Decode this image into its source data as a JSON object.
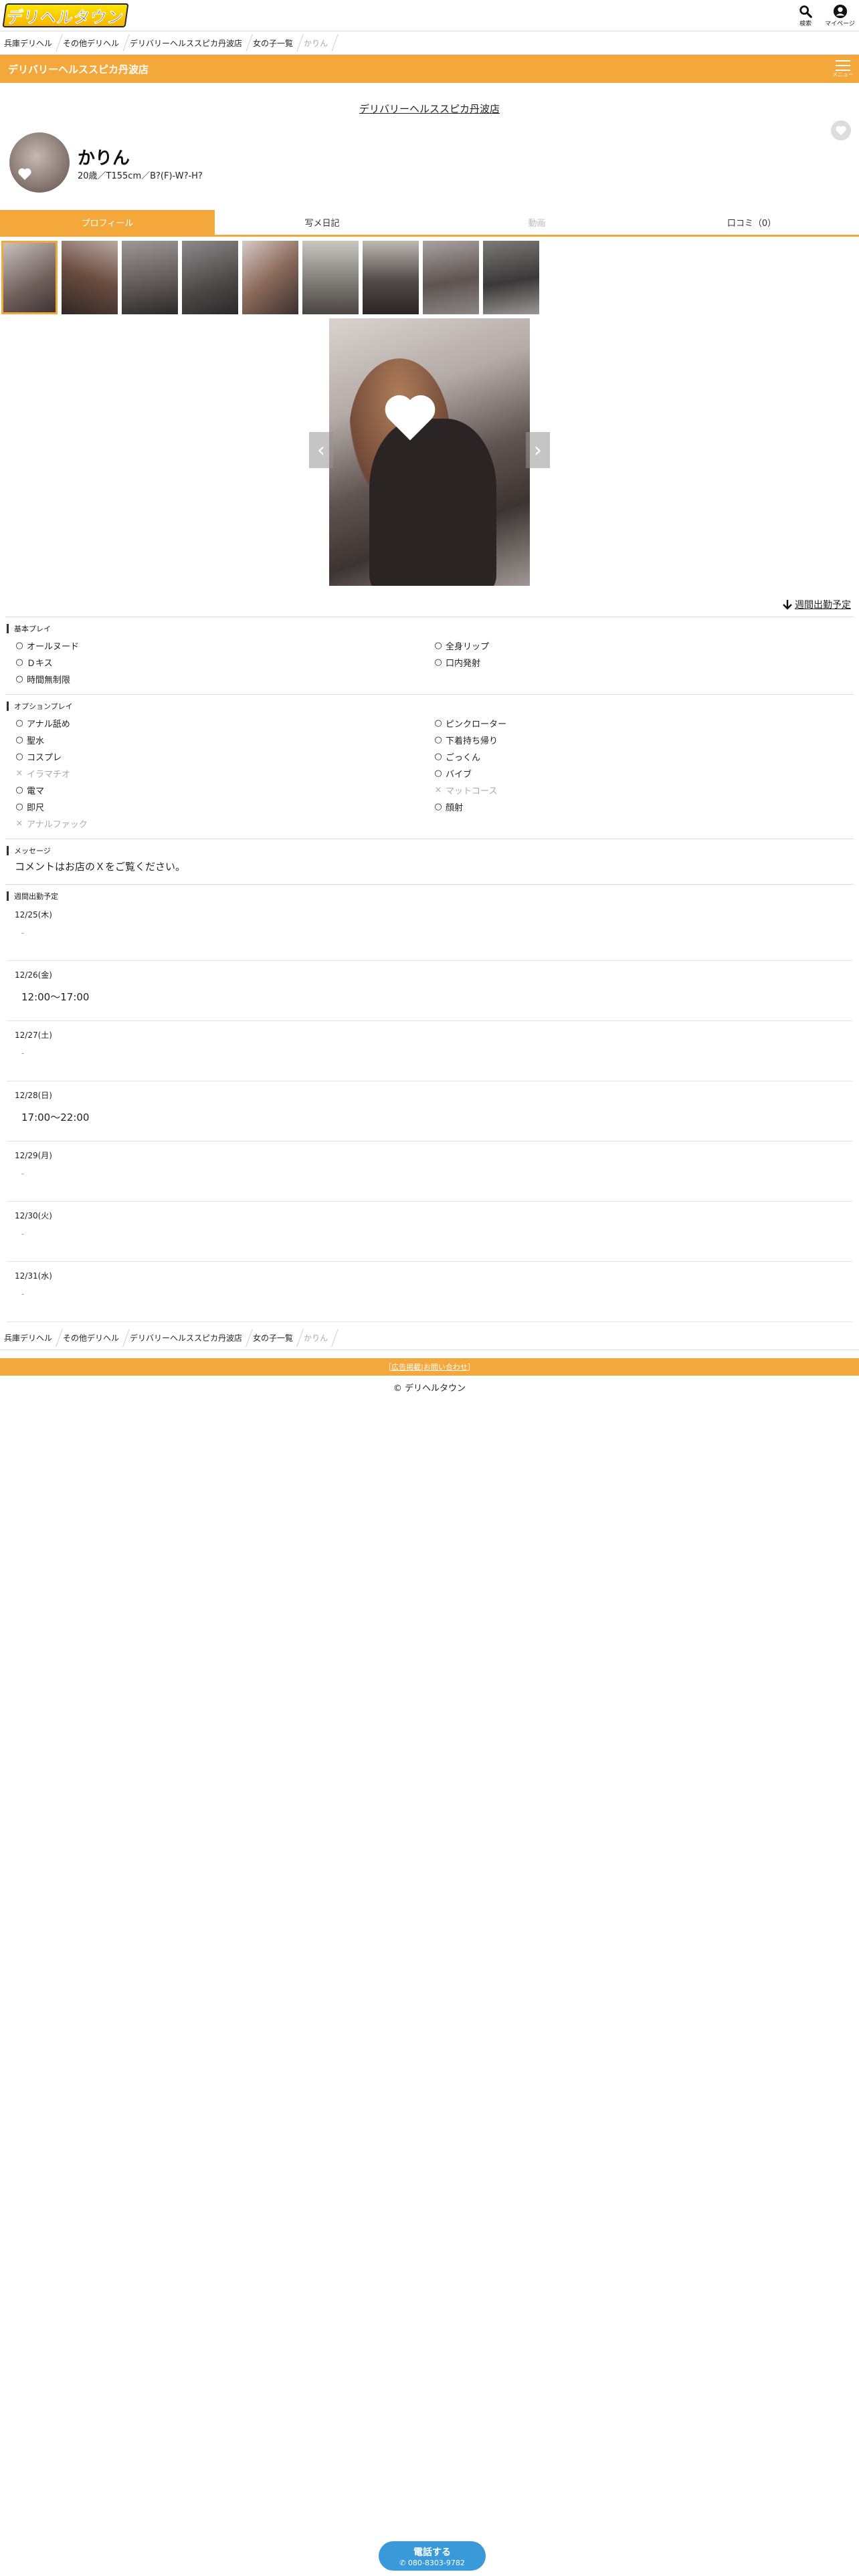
{
  "header": {
    "logo_text": "デリヘルタウン",
    "search_label": "検索",
    "mypage_label": "マイページ"
  },
  "breadcrumb": [
    "兵庫デリヘル",
    "その他デリヘル",
    "デリバリーヘルススピカ丹波店",
    "女の子一覧",
    "かりん"
  ],
  "shop_bar": {
    "title": "デリバリーヘルススピカ丹波店",
    "menu_label": "メニュー"
  },
  "shop_link": "デリバリーヘルススピカ丹波店",
  "profile": {
    "name": "かりん",
    "spec": "20歳／T155cm／B?(F)-W?-H?"
  },
  "tabs": [
    {
      "label": "プロフィール",
      "state": "active"
    },
    {
      "label": "写メ日記",
      "state": "normal"
    },
    {
      "label": "動画",
      "state": "disabled"
    },
    {
      "label": "口コミ（0）",
      "state": "normal"
    }
  ],
  "thumb_count": 9,
  "schedule_link": "週間出勤予定",
  "basic_play": {
    "title": "基本プレイ",
    "items": [
      {
        "mark": "○",
        "label": "オールヌード",
        "ok": true
      },
      {
        "mark": "○",
        "label": "全身リップ",
        "ok": true
      },
      {
        "mark": "○",
        "label": "Ｄキス",
        "ok": true
      },
      {
        "mark": "○",
        "label": "口内発射",
        "ok": true
      },
      {
        "mark": "○",
        "label": "時間無制限",
        "ok": true
      }
    ]
  },
  "option_play": {
    "title": "オプションプレイ",
    "items": [
      {
        "mark": "○",
        "label": "アナル舐め",
        "ok": true
      },
      {
        "mark": "○",
        "label": "ピンクローター",
        "ok": true
      },
      {
        "mark": "○",
        "label": "聖水",
        "ok": true
      },
      {
        "mark": "○",
        "label": "下着持ち帰り",
        "ok": true
      },
      {
        "mark": "○",
        "label": "コスプレ",
        "ok": true
      },
      {
        "mark": "○",
        "label": "ごっくん",
        "ok": true
      },
      {
        "mark": "×",
        "label": "イラマチオ",
        "ok": false
      },
      {
        "mark": "○",
        "label": "バイブ",
        "ok": true
      },
      {
        "mark": "○",
        "label": "電マ",
        "ok": true
      },
      {
        "mark": "×",
        "label": "マットコース",
        "ok": false
      },
      {
        "mark": "○",
        "label": "即尺",
        "ok": true
      },
      {
        "mark": "○",
        "label": "顔射",
        "ok": true
      },
      {
        "mark": "×",
        "label": "アナルファック",
        "ok": false
      }
    ]
  },
  "message": {
    "title": "メッセージ",
    "text": "コメントはお店のＸをご覧ください。"
  },
  "weekly": {
    "title": "週間出勤予定",
    "days": [
      {
        "date": "12/25(木)",
        "time": "-"
      },
      {
        "date": "12/26(金)",
        "time": "12:00〜17:00"
      },
      {
        "date": "12/27(土)",
        "time": "-"
      },
      {
        "date": "12/28(日)",
        "time": "17:00〜22:00"
      },
      {
        "date": "12/29(月)",
        "time": "-"
      },
      {
        "date": "12/30(火)",
        "time": "-"
      },
      {
        "date": "12/31(水)",
        "time": "-"
      }
    ]
  },
  "footer": {
    "links": [
      "広告掲載",
      "お問い合わせ"
    ],
    "copyright": "© デリヘルタウン"
  },
  "call": {
    "label": "電話する",
    "number": "080-8303-9782"
  }
}
